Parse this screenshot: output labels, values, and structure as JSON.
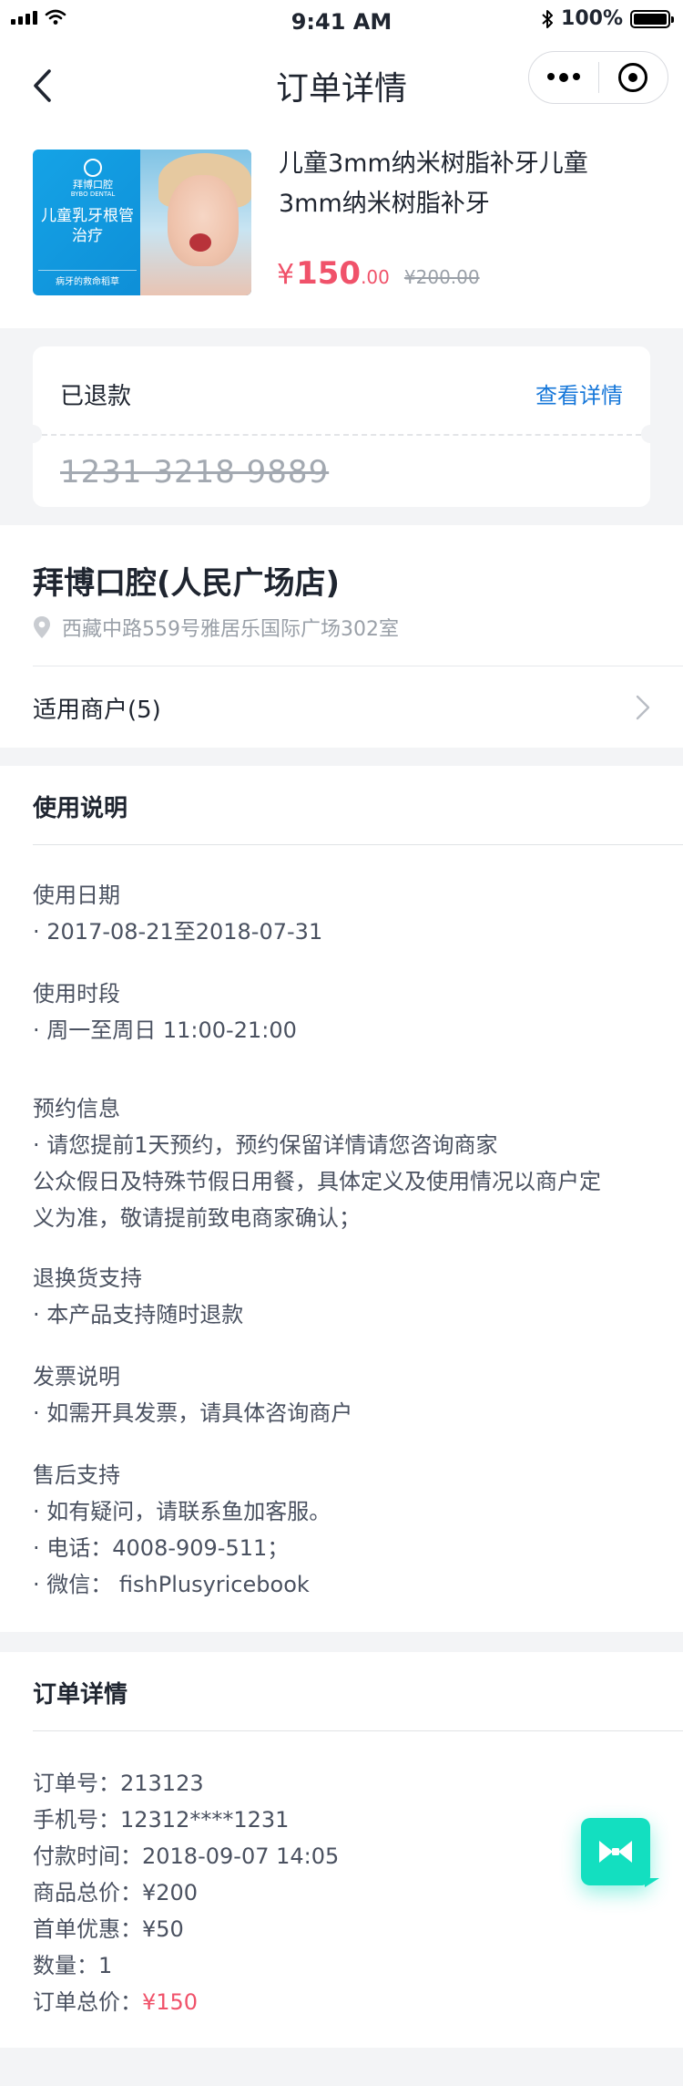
{
  "status_bar": {
    "time": "9:41 AM",
    "battery_percent": "100%",
    "battery_level": 1.0
  },
  "nav": {
    "title": "订单详情",
    "icons": [
      "back-arrow-icon",
      "more-dots-icon",
      "close-target-icon"
    ]
  },
  "product": {
    "title": "儿童3mm纳米树脂补牙儿童3mm纳米树脂补牙",
    "image": {
      "brand_cn": "拜博口腔",
      "brand_en": "BYBO DENTAL",
      "headline": "儿童乳牙根管治疗",
      "tagline": "病牙的救命稻草"
    },
    "price_currency": "¥",
    "price_main": "150",
    "price_decimal": ".00",
    "price_original": "¥200.00"
  },
  "refund": {
    "status": "已退款",
    "link": "查看详情",
    "code": "1231 3218 9889"
  },
  "store": {
    "name": "拜博口腔(人民广场店)",
    "address": "西藏中路559号雅居乐国际广场302室",
    "merchants_label": "适用商户(5)"
  },
  "usage": {
    "title": "使用说明",
    "sections": [
      {
        "heading": "使用日期",
        "lines": [
          "· 2017-08-21至2018-07-31"
        ]
      },
      {
        "heading": "使用时段",
        "lines": [
          "· 周一至周日 11:00-21:00"
        ]
      },
      {
        "heading": "预约信息",
        "lines": [
          "· 请您提前1天预约，预约保留详情请您咨询商家",
          "公众假日及特殊节假日用餐，具体定义及使用情况以商户定",
          "义为准，敬请提前致电商家确认；"
        ]
      },
      {
        "heading": "退换货支持",
        "lines": [
          "· 本产品支持随时退款"
        ]
      },
      {
        "heading": "发票说明",
        "lines": [
          "· 如需开具发票，请具体咨询商户"
        ]
      },
      {
        "heading": "售后支持",
        "lines": [
          "· 如有疑问，请联系鱼加客服。",
          "· 电话：4008-909-511；",
          "· 微信： fishPlusyricebook"
        ]
      }
    ]
  },
  "order": {
    "title": "订单详情",
    "lines": [
      {
        "label": "订单号：",
        "value": "213123"
      },
      {
        "label": "手机号：",
        "value": "12312****1231"
      },
      {
        "label": "付款时间：",
        "value": "2018-09-07 14:05"
      },
      {
        "label": "商品总价：",
        "value": "¥200"
      },
      {
        "label": "首单优惠：",
        "value": "¥50"
      },
      {
        "label": "数量：",
        "value": "1"
      },
      {
        "label": "订单总价：",
        "value": "¥150"
      }
    ]
  },
  "colors": {
    "accent_red": "#f0526a",
    "link_blue": "#1677d9",
    "fab_teal": "#13dfc0"
  }
}
